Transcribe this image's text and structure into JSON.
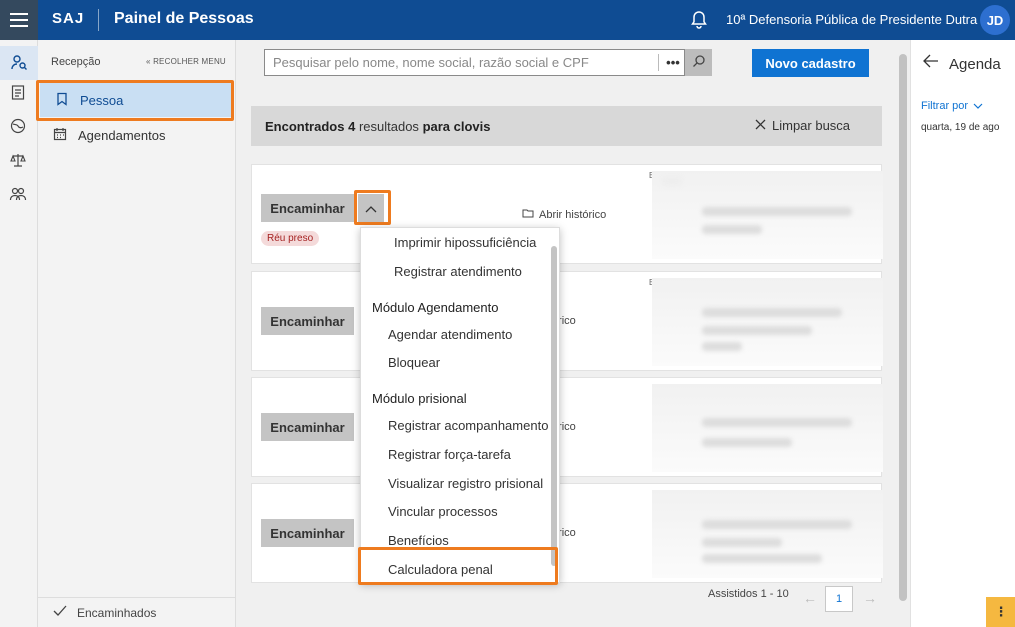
{
  "header": {
    "brand": "SAJ",
    "title": "Painel de Pessoas",
    "org": "10ª Defensoria Pública de Presidente Dutra",
    "avatar": "JD"
  },
  "rail": {
    "icons": [
      "person-search-icon",
      "clipboard-icon",
      "globe-icon",
      "scale-icon",
      "people-icon"
    ]
  },
  "sidemenu": {
    "title": "Recepção",
    "collapse": "RECOLHER MENU",
    "items": [
      {
        "label": "Pessoa",
        "icon": "bookmark-icon",
        "active": true
      },
      {
        "label": "Agendamentos",
        "icon": "calendar-icon",
        "active": false
      }
    ],
    "bottom": "Encaminhados"
  },
  "search": {
    "placeholder": "Pesquisar pelo nome, nome social, razão social e CPF",
    "more": "•••"
  },
  "new_button": "Novo cadastro",
  "results": {
    "prefix": "Encontrados",
    "count": "4",
    "middle": "resultados",
    "for": "para clovis",
    "clear": "Limpar busca"
  },
  "cards": [
    {
      "button": "Encaminhar",
      "badge": "Réu preso",
      "history": "Abrir histórico",
      "mark": "E"
    },
    {
      "button": "Encaminhar",
      "history": "rir histórico",
      "mark": "E"
    },
    {
      "button": "Encaminhar",
      "history": "rir histórico"
    },
    {
      "button": "Encaminhar",
      "history": "rir histórico"
    }
  ],
  "dropdown": {
    "items_top": [
      "Imprimir hipossuficiência",
      "Registrar atendimento"
    ],
    "section1": "Módulo Agendamento",
    "items_agenda": [
      "Agendar atendimento",
      "Bloquear"
    ],
    "section2": "Módulo prisional",
    "items_prisional": [
      "Registrar acompanhamento",
      "Registrar força-tarefa",
      "Visualizar registro prisional",
      "Vincular processos",
      "Benefícios",
      "Calculadora penal"
    ]
  },
  "pager": {
    "label": "Assistidos 1 - 10",
    "page": "1"
  },
  "agenda": {
    "title": "Agenda",
    "filter": "Filtrar por",
    "date": "quarta, 19 de ago",
    "kebab": "⋮"
  },
  "colors": {
    "header": "#0f4c93",
    "primary": "#0f73d2",
    "highlight": "#ee7b1f"
  }
}
